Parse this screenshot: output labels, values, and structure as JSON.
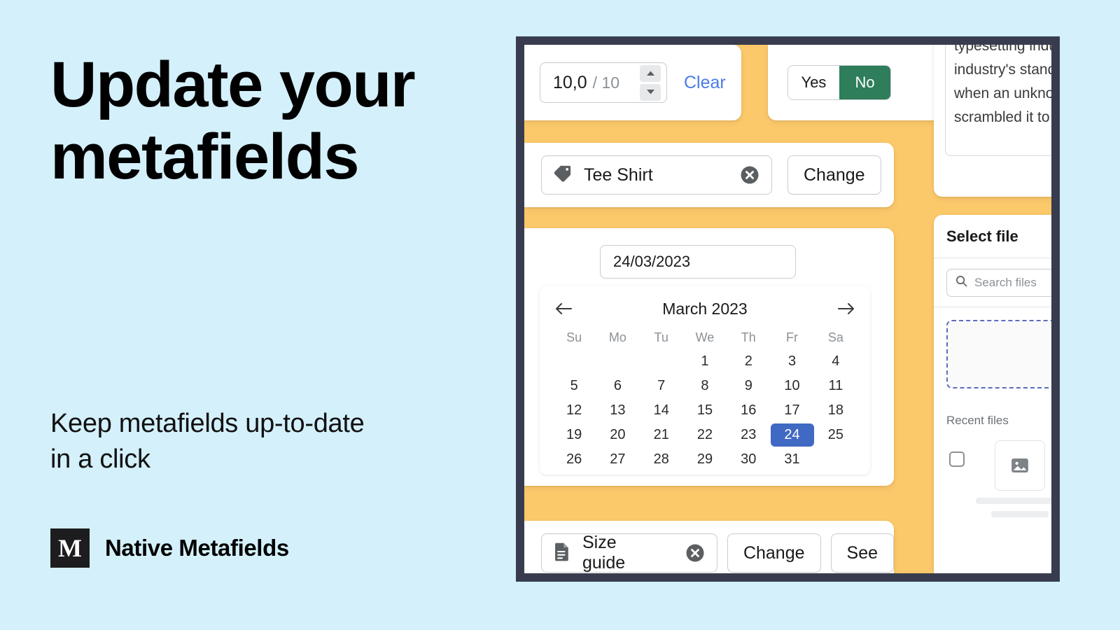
{
  "marketing": {
    "headline_line1": "Update your",
    "headline_line2": "metafields",
    "subhead_line1": "Keep metafields up-to-date",
    "subhead_line2": "in a click",
    "brand_mark": "M",
    "brand_name": "Native Metafields"
  },
  "colors": {
    "page_background": "#D4F0FB",
    "frame_border": "#383C4E",
    "app_background": "#FBC86A",
    "accent_blue_link": "#4A7BE8",
    "accent_blue_selected": "#4069C4",
    "accent_green": "#2E7D5B",
    "text_primary": "#1A1A1A",
    "text_muted": "#8C9196"
  },
  "number_field": {
    "value": "10,0",
    "max_label": "/ 10",
    "clear_label": "Clear",
    "increment_icon": "caret-up-icon",
    "decrement_icon": "caret-down-icon"
  },
  "boolean_field": {
    "options": [
      "Yes",
      "No"
    ],
    "selected": "No"
  },
  "text_field": {
    "lines": [
      "typesetting indu",
      "industry's stand",
      "when an unknow",
      "scrambled it to m"
    ]
  },
  "product_reference": {
    "icon": "tag-icon",
    "label": "Tee Shirt",
    "remove_icon": "circle-x-icon",
    "change_label": "Change"
  },
  "date_field": {
    "input_value": "24/03/2023",
    "prev_icon": "arrow-left-icon",
    "next_icon": "arrow-right-icon",
    "month_title": "March 2023",
    "weekdays": [
      "Su",
      "Mo",
      "Tu",
      "We",
      "Th",
      "Fr",
      "Sa"
    ],
    "weeks": [
      [
        "",
        "",
        "",
        "1",
        "2",
        "3",
        "4"
      ],
      [
        "5",
        "6",
        "7",
        "8",
        "9",
        "10",
        "11"
      ],
      [
        "12",
        "13",
        "14",
        "15",
        "16",
        "17",
        "18"
      ],
      [
        "19",
        "20",
        "21",
        "22",
        "23",
        "24",
        "25"
      ],
      [
        "26",
        "27",
        "28",
        "29",
        "30",
        "31",
        ""
      ]
    ],
    "selected_day": "24"
  },
  "file_reference": {
    "icon": "document-icon",
    "label": "Size guide",
    "remove_icon": "circle-x-icon",
    "change_label": "Change",
    "see_label": "See"
  },
  "file_picker": {
    "title": "Select file",
    "search_icon": "search-icon",
    "search_placeholder": "Search files",
    "search_value": "",
    "dropzone_label": "",
    "recent_label": "Recent files",
    "recent_item": {
      "checkbox_checked": false,
      "thumbnail_icon": "image-placeholder-icon"
    }
  }
}
